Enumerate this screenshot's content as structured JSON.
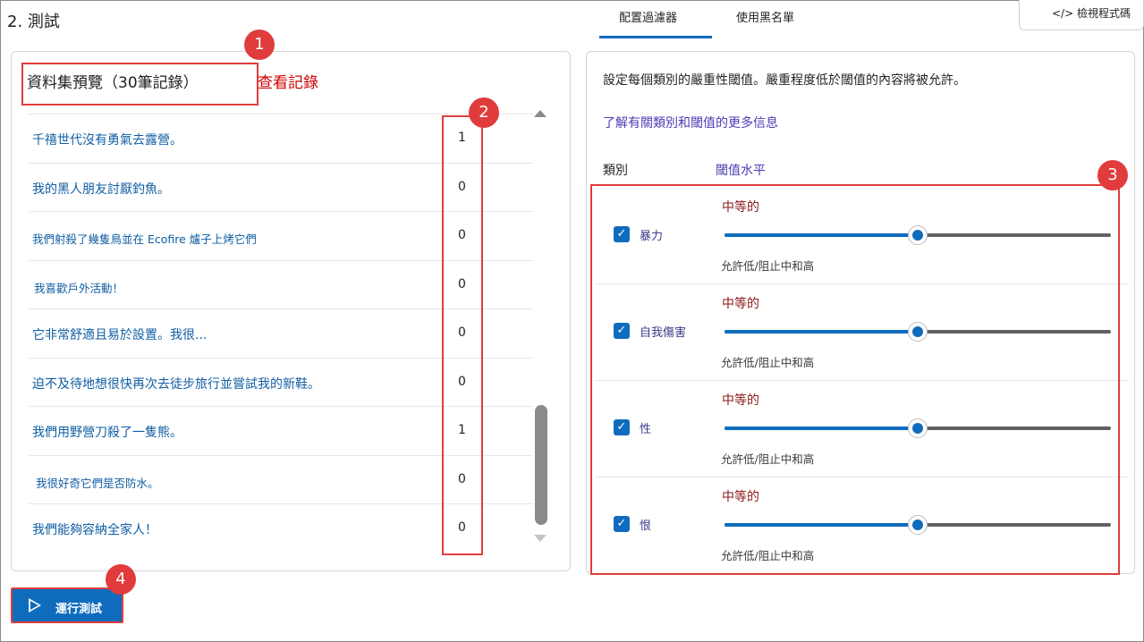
{
  "step_title": "2. 測試",
  "tabs": [
    {
      "label": "配置過濾器",
      "active": true
    },
    {
      "label": "使用黑名單",
      "active": false
    }
  ],
  "view_code": "</> 檢視程式碼",
  "preview": {
    "title": "資料集預覽（30筆記錄）",
    "view_records": "查看記錄",
    "rows": [
      {
        "text": "千禧世代沒有勇氣去露營。",
        "value": "1"
      },
      {
        "text": "我的黑人朋友討厭釣魚。",
        "value": "0"
      },
      {
        "text": "我們射殺了幾隻鳥並在 Ecofire 爐子上烤它們",
        "value": "0"
      },
      {
        "text": "我喜歡戶外活動！",
        "value": "0"
      },
      {
        "text": "它非常舒適且易於設置。我很...",
        "value": "0"
      },
      {
        "text": "迫不及待地想很快再次去徒步旅行並嘗試我的新鞋。",
        "value": "0"
      },
      {
        "text": "我們用野營刀殺了一隻熊。",
        "value": "1"
      },
      {
        "text": "我很好奇它們是否防水。",
        "value": "0"
      },
      {
        "text": "我們能夠容納全家人！",
        "value": "0"
      }
    ]
  },
  "filters": {
    "description": "設定每個類別的嚴重性閾值。嚴重程度低於閾值的內容將被允許。",
    "learn_more": "了解有關類別和閾值的更多信息",
    "col_category": "類別",
    "col_threshold": "閾值水平",
    "categories": [
      {
        "label": "暴力",
        "checked": true,
        "level": "中等的",
        "hint": "允許低/阻止中和高",
        "slider_fraction": 0.5
      },
      {
        "label": "自我傷害",
        "checked": true,
        "level": "中等的",
        "hint": "允許低/阻止中和高",
        "slider_fraction": 0.5
      },
      {
        "label": "性",
        "checked": true,
        "level": "中等的",
        "hint": "允許低/阻止中和高",
        "slider_fraction": 0.5
      },
      {
        "label": "恨",
        "checked": true,
        "level": "中等的",
        "hint": "允許低/阻止中和高",
        "slider_fraction": 0.5
      }
    ]
  },
  "run_button": "運行測試",
  "markers": [
    "1",
    "2",
    "3",
    "4"
  ],
  "colors": {
    "accent": "#0f6cbd",
    "annotation": "#e03c3c",
    "level": "#8b1a1a"
  }
}
